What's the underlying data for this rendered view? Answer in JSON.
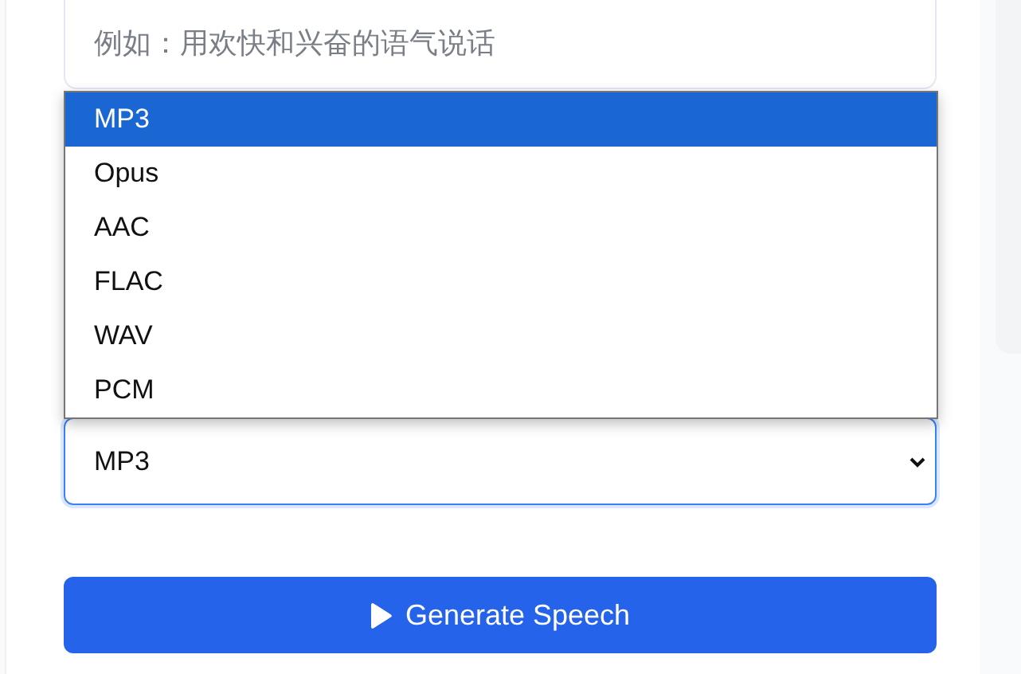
{
  "instruction_field": {
    "placeholder": "例如：用欢快和兴奋的语气说话"
  },
  "format_select": {
    "value": "MP3",
    "expanded": true,
    "options": [
      {
        "label": "MP3",
        "selected": true
      },
      {
        "label": "Opus",
        "selected": false
      },
      {
        "label": "AAC",
        "selected": false
      },
      {
        "label": "FLAC",
        "selected": false
      },
      {
        "label": "WAV",
        "selected": false
      },
      {
        "label": "PCM",
        "selected": false
      }
    ]
  },
  "generate_button": {
    "label": "Generate Speech"
  }
}
